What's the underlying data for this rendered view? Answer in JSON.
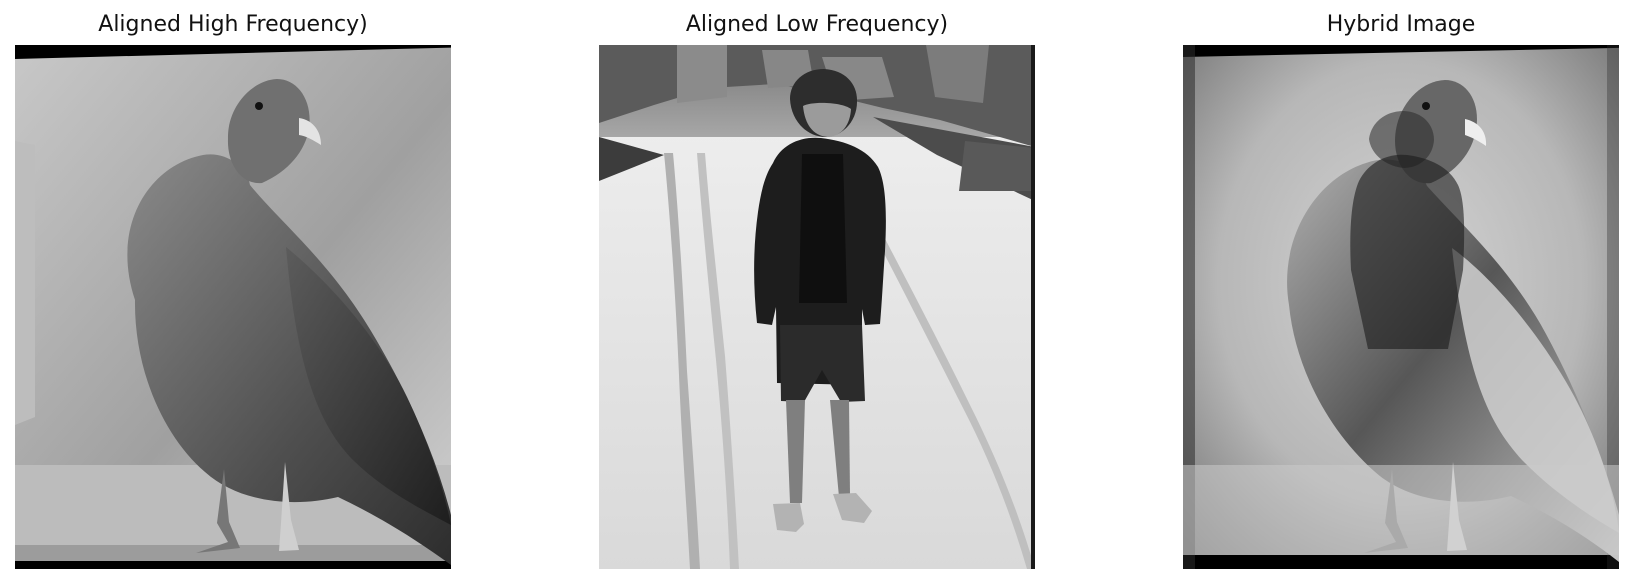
{
  "figure": {
    "panels": [
      {
        "title": "Aligned High Frequency)",
        "subject": "pigeon"
      },
      {
        "title": "Aligned Low Frequency)",
        "subject": "person standing on snowy road"
      },
      {
        "title": "Hybrid Image",
        "subject": "hybrid pigeon and person"
      }
    ]
  },
  "colors": {
    "background": "#ffffff",
    "title_text": "#111111",
    "image_black": "#000000",
    "image_dark": "#353535",
    "image_mid": "#8f8f8f",
    "image_light": "#d8d8d8"
  }
}
